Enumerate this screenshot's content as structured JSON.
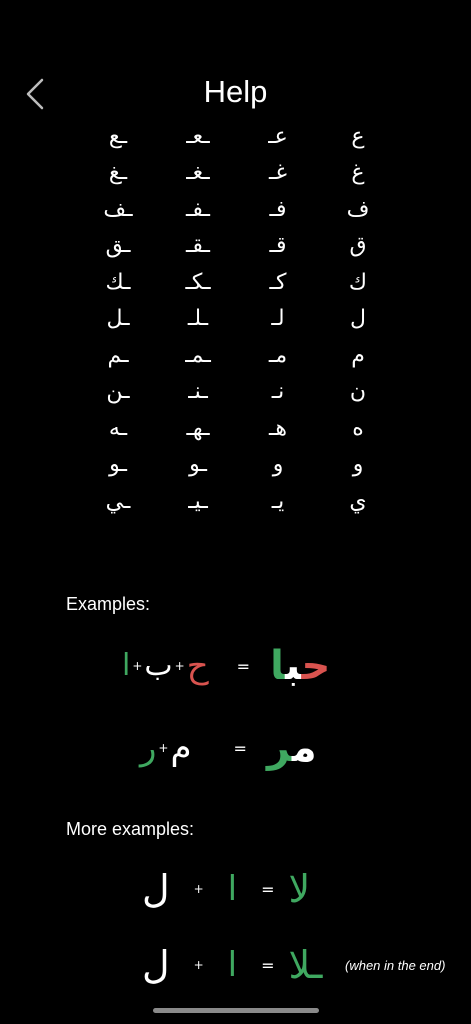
{
  "header": {
    "title": "Help",
    "back_icon": "chevron-left-icon"
  },
  "letters": [
    [
      "ع",
      "عـ",
      "ـعـ",
      "ـع"
    ],
    [
      "غ",
      "غـ",
      "ـغـ",
      "ـغ"
    ],
    [
      "ف",
      "فـ",
      "ـفـ",
      "ـف"
    ],
    [
      "ق",
      "قـ",
      "ـقـ",
      "ـق"
    ],
    [
      "ك",
      "كـ",
      "ـكـ",
      "ـك"
    ],
    [
      "ل",
      "لـ",
      "ـلـ",
      "ـل"
    ],
    [
      "م",
      "مـ",
      "ـمـ",
      "ـم"
    ],
    [
      "ن",
      "نـ",
      "ـنـ",
      "ـن"
    ],
    [
      "ه",
      "هـ",
      "ـهـ",
      "ـه"
    ],
    [
      "و",
      "و",
      "ـو",
      "ـو"
    ],
    [
      "ي",
      "يـ",
      "ـيـ",
      "ـي"
    ]
  ],
  "examples": {
    "label": "Examples:",
    "ex1": {
      "a": "ح",
      "b": "ب",
      "c": "ا",
      "plus": "+",
      "eq": "=",
      "result_1": "ح",
      "result_2": "ب",
      "result_3": "ا"
    },
    "ex2": {
      "a": "م",
      "b": "ر",
      "plus": "+",
      "eq": "=",
      "result_1": "م",
      "result_2": "ر"
    }
  },
  "more_examples": {
    "label": "More examples:",
    "ex3": {
      "a": "ل",
      "b": "ا",
      "plus": "+",
      "eq": "=",
      "result": "لا"
    },
    "ex4": {
      "a": "ل",
      "b": "ا",
      "plus": "+",
      "eq": "=",
      "result": "ـلا",
      "note": "(when in the end)"
    }
  },
  "colors": {
    "red": "#d9534f",
    "green": "#3fa860",
    "white": "#ffffff",
    "background": "#000000"
  }
}
